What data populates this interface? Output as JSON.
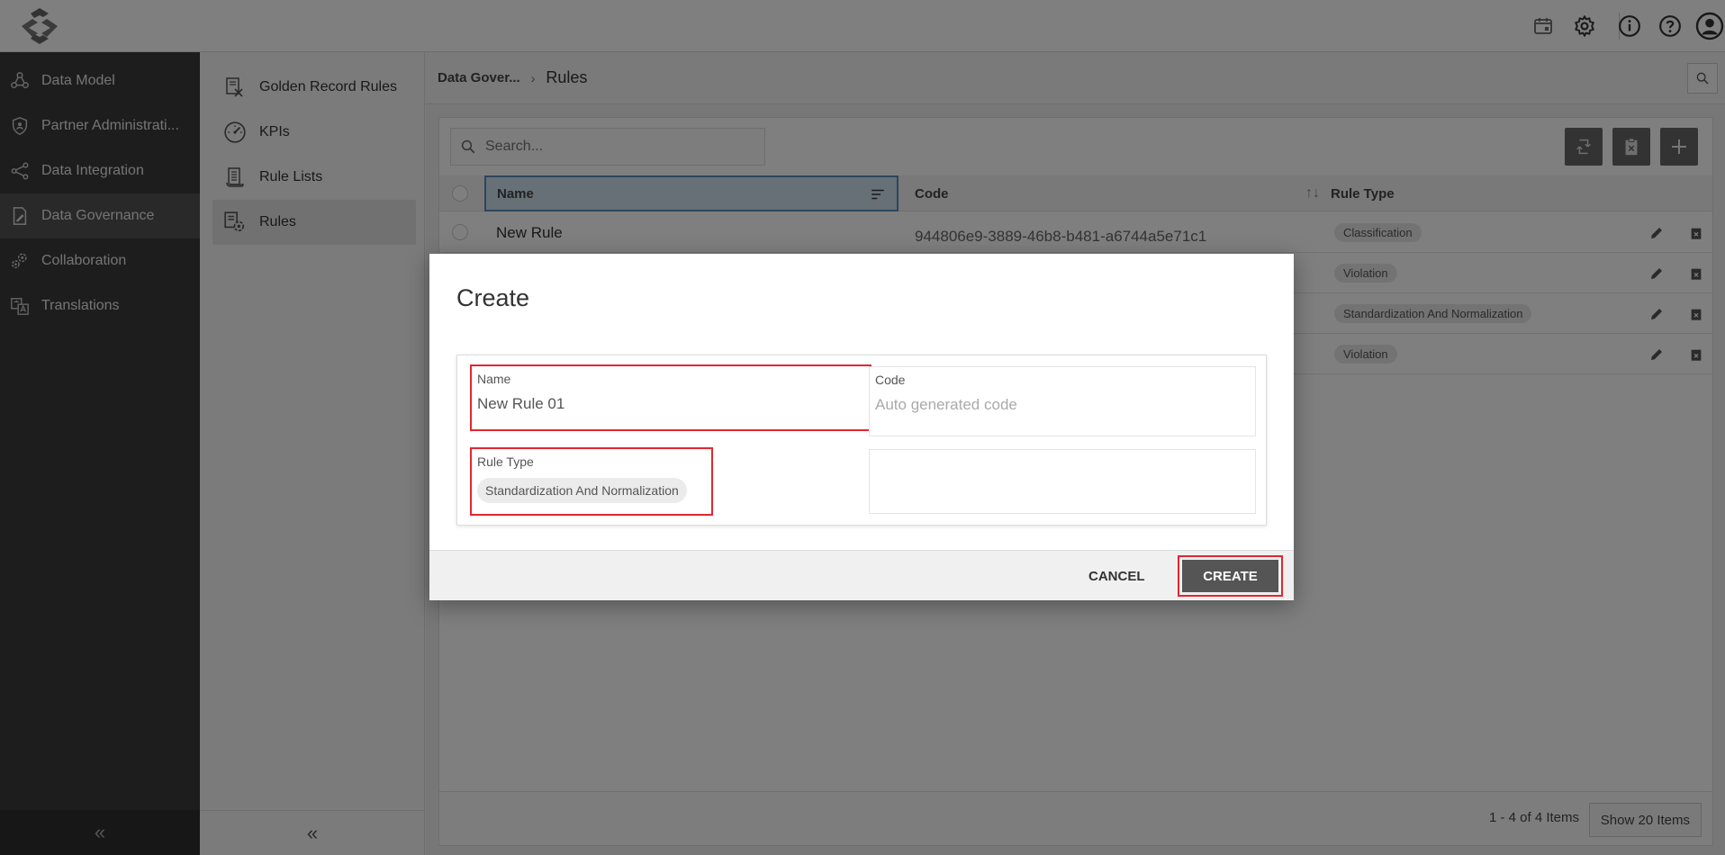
{
  "sidebar": {
    "items": [
      {
        "label": "Data Model",
        "icon": "cube-network-icon"
      },
      {
        "label": "Partner Administrati...",
        "icon": "shield-icon"
      },
      {
        "label": "Data Integration",
        "icon": "share-nodes-icon"
      },
      {
        "label": "Data Governance",
        "icon": "document-edit-icon"
      },
      {
        "label": "Collaboration",
        "icon": "gears-icon"
      },
      {
        "label": "Translations",
        "icon": "translate-icon"
      }
    ],
    "active": "Data Governance",
    "collapse_glyph": "«"
  },
  "subnav": {
    "items": [
      {
        "label": "Golden Record Rules"
      },
      {
        "label": "KPIs"
      },
      {
        "label": "Rule Lists"
      },
      {
        "label": "Rules"
      }
    ],
    "active": "Rules",
    "collapse_glyph": "«"
  },
  "breadcrumb": {
    "parent": "Data Gover...",
    "separator": "›",
    "current": "Rules"
  },
  "grid": {
    "search_placeholder": "Search...",
    "columns": {
      "name": "Name",
      "code": "Code",
      "rule_type": "Rule Type"
    },
    "rows": [
      {
        "name": "New Rule",
        "code": "944806e9-3889-46b8-b481-a6744a5e71c1",
        "rule_type": "Classification"
      },
      {
        "name": "",
        "code": "",
        "rule_type": "Violation"
      },
      {
        "name": "",
        "code": "",
        "rule_type": "Standardization And Normalization"
      },
      {
        "name": "",
        "code": "",
        "rule_type": "Violation"
      }
    ],
    "pager_text": "1 - 4 of 4 Items",
    "page_size_label": "Show 20 Items"
  },
  "modal": {
    "title": "Create",
    "name_label": "Name",
    "name_value": "New Rule 01",
    "code_label": "Code",
    "code_placeholder": "Auto generated code",
    "rule_type_label": "Rule Type",
    "rule_type_value": "Standardization And Normalization",
    "cancel_label": "CANCEL",
    "create_label": "CREATE"
  },
  "colors": {
    "highlight": "#e3262f",
    "sidebar_bg": "#3a3a3a",
    "primary_button": "#555555"
  }
}
